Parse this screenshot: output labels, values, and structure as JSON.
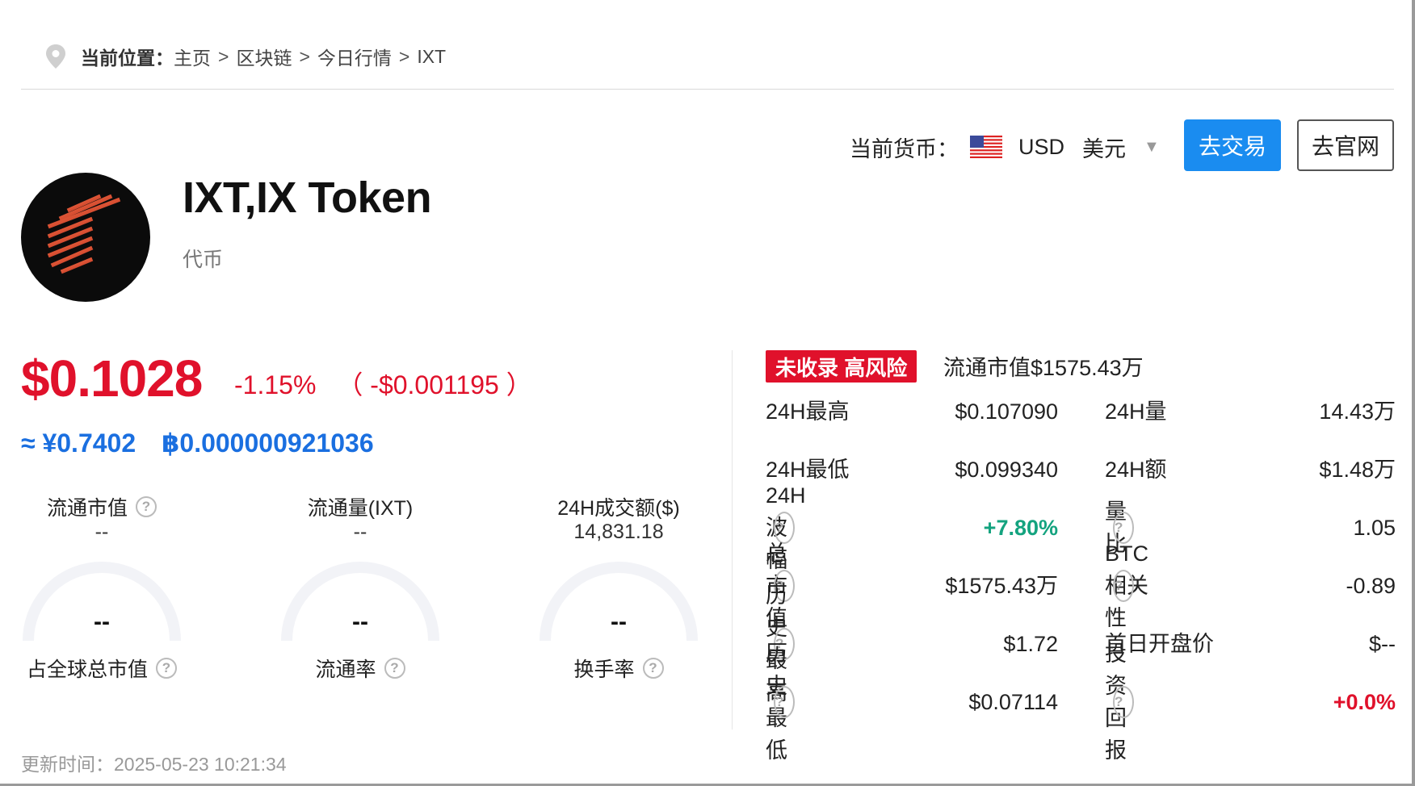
{
  "breadcrumb": {
    "label": "当前位置：",
    "items": [
      "主页",
      "区块链",
      "今日行情",
      "IXT"
    ],
    "separator": ">"
  },
  "currency": {
    "label": "当前货币：",
    "code": "USD",
    "name": "美元",
    "caret": "▼"
  },
  "buttons": {
    "trade": "去交易",
    "website": "去官网"
  },
  "token": {
    "name": "IXT,IX Token",
    "type": "代币"
  },
  "price": {
    "main": "$0.1028",
    "change_pct": "-1.15%",
    "change_amt": "（ -$0.001195 ）",
    "cny": "≈ ¥0.7402",
    "btc": "฿0.000000921036"
  },
  "gauges": [
    {
      "title": "流通市值",
      "help": true,
      "value": "--",
      "center": "--",
      "footer": "占全球总市值"
    },
    {
      "title": "流通量(IXT)",
      "help": false,
      "value": "--",
      "center": "--",
      "footer": "流通率"
    },
    {
      "title": "24H成交额($)",
      "help": false,
      "value": "14,831.18",
      "center": "--",
      "footer": "换手率"
    }
  ],
  "risk_badge": "未收录 高风险",
  "circ_mcap": "流通市值$1575.43万",
  "stats": [
    {
      "l1": "24H最高",
      "h1": false,
      "v1": "$0.107090",
      "l2": "24H量",
      "h2": false,
      "v2": "14.43万"
    },
    {
      "l1": "24H最低",
      "h1": false,
      "v1": "$0.099340",
      "l2": "24H额",
      "h2": false,
      "v2": "$1.48万"
    },
    {
      "l1": "24H波幅",
      "h1": true,
      "v1": "+7.80%",
      "l2": "量比",
      "h2": true,
      "v2": "1.05"
    },
    {
      "l1": "总市值",
      "h1": true,
      "v1": "$1575.43万",
      "l2": "BTC相关性",
      "h2": true,
      "v2": "-0.89"
    },
    {
      "l1": "历史最高",
      "h1": true,
      "v1": "$1.72",
      "l2": "首日开盘价",
      "h2": false,
      "v2": "$--"
    },
    {
      "l1": "历史最低",
      "h1": true,
      "v1": "$0.07114",
      "l2": "投资回报",
      "h2": true,
      "v2": "+0.0%"
    }
  ],
  "help_glyph": "?",
  "updated": "更新时间：2025-05-23 10:21:34",
  "colors": {
    "red": "#e0112b",
    "blue": "#1a6fe0",
    "green": "#14a37f",
    "button": "#1a8cf0"
  }
}
